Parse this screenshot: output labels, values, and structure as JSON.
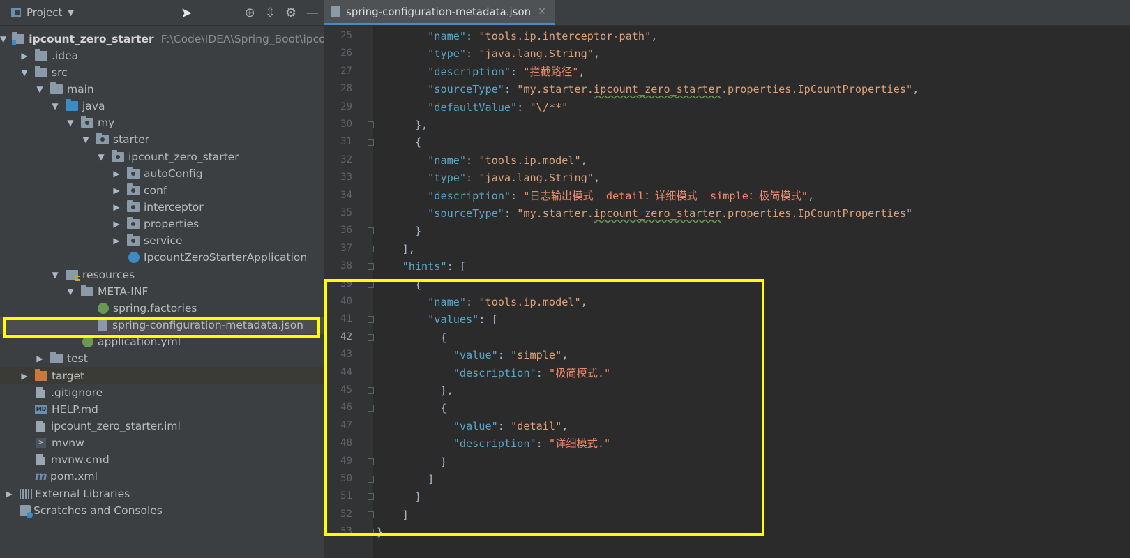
{
  "project_panel": {
    "title": "Project",
    "tree": [
      {
        "label": "ipcount_zero_starter",
        "path": "F:\\Code\\IDEA\\Spring_Boot\\ipcount",
        "depth": 0,
        "expanded": true,
        "icon": "module-folder-icon",
        "bold": true
      },
      {
        "label": ".idea",
        "depth": 1,
        "expanded": false,
        "icon": "folder-icon"
      },
      {
        "label": "src",
        "depth": 1,
        "expanded": true,
        "icon": "folder-icon"
      },
      {
        "label": "main",
        "depth": 2,
        "expanded": true,
        "icon": "folder-icon"
      },
      {
        "label": "java",
        "depth": 3,
        "expanded": true,
        "icon": "source-folder-icon"
      },
      {
        "label": "my",
        "depth": 4,
        "expanded": true,
        "icon": "package-icon"
      },
      {
        "label": "starter",
        "depth": 5,
        "expanded": true,
        "icon": "package-icon"
      },
      {
        "label": "ipcount_zero_starter",
        "depth": 6,
        "expanded": true,
        "icon": "package-icon"
      },
      {
        "label": "autoConfig",
        "depth": 7,
        "expanded": false,
        "icon": "package-icon"
      },
      {
        "label": "conf",
        "depth": 7,
        "expanded": false,
        "icon": "package-icon"
      },
      {
        "label": "interceptor",
        "depth": 7,
        "expanded": false,
        "icon": "package-icon"
      },
      {
        "label": "properties",
        "depth": 7,
        "expanded": false,
        "icon": "package-icon"
      },
      {
        "label": "service",
        "depth": 7,
        "expanded": false,
        "icon": "package-icon"
      },
      {
        "label": "IpcountZeroStarterApplication",
        "depth": 7,
        "icon": "spring-boot-app-icon"
      },
      {
        "label": "resources",
        "depth": 3,
        "expanded": true,
        "icon": "resources-folder-icon"
      },
      {
        "label": "META-INF",
        "depth": 4,
        "expanded": true,
        "icon": "folder-icon"
      },
      {
        "label": "spring.factories",
        "depth": 5,
        "icon": "spring-leaf-icon"
      },
      {
        "label": "spring-configuration-metadata.json",
        "depth": 5,
        "icon": "json-file-icon",
        "selected": true
      },
      {
        "label": "application.yml",
        "depth": 4,
        "icon": "spring-config-icon"
      },
      {
        "label": "test",
        "depth": 2,
        "expanded": false,
        "icon": "folder-icon"
      },
      {
        "label": "target",
        "depth": 1,
        "expanded": false,
        "icon": "excluded-folder-icon"
      },
      {
        "label": ".gitignore",
        "depth": 1,
        "icon": "text-file-icon"
      },
      {
        "label": "HELP.md",
        "depth": 1,
        "icon": "markdown-file-icon"
      },
      {
        "label": "ipcount_zero_starter.iml",
        "depth": 1,
        "icon": "iml-file-icon"
      },
      {
        "label": "mvnw",
        "depth": 1,
        "icon": "shell-file-icon"
      },
      {
        "label": "mvnw.cmd",
        "depth": 1,
        "icon": "text-file-icon"
      },
      {
        "label": "pom.xml",
        "depth": 1,
        "icon": "maven-icon"
      },
      {
        "label": "External Libraries",
        "depth": 0,
        "expanded": false,
        "icon": "libraries-icon"
      },
      {
        "label": "Scratches and Consoles",
        "depth": 0,
        "icon": "scratches-icon"
      }
    ]
  },
  "editor": {
    "tab_title": "spring-configuration-metadata.json",
    "current_line": 42,
    "lines": [
      {
        "n": 25,
        "text": "        \"name\": \"tools.ip.interceptor-path\","
      },
      {
        "n": 26,
        "text": "        \"type\": \"java.lang.String\","
      },
      {
        "n": 27,
        "text": "        \"description\": \"拦截路径\","
      },
      {
        "n": 28,
        "text": "        \"sourceType\": \"my.starter.ipcount_zero_starter.properties.IpCountProperties\","
      },
      {
        "n": 29,
        "text": "        \"defaultValue\": \"\\/**\""
      },
      {
        "n": 30,
        "text": "      },"
      },
      {
        "n": 31,
        "text": "      {"
      },
      {
        "n": 32,
        "text": "        \"name\": \"tools.ip.model\","
      },
      {
        "n": 33,
        "text": "        \"type\": \"java.lang.String\","
      },
      {
        "n": 34,
        "text": "        \"description\": \"日志输出模式  detail：详细模式  simple：极简模式\","
      },
      {
        "n": 35,
        "text": "        \"sourceType\": \"my.starter.ipcount_zero_starter.properties.IpCountProperties\""
      },
      {
        "n": 36,
        "text": "      }"
      },
      {
        "n": 37,
        "text": "    ],"
      },
      {
        "n": 38,
        "text": "    \"hints\": ["
      },
      {
        "n": 39,
        "text": "      {"
      },
      {
        "n": 40,
        "text": "        \"name\": \"tools.ip.model\","
      },
      {
        "n": 41,
        "text": "        \"values\": ["
      },
      {
        "n": 42,
        "text": "          {"
      },
      {
        "n": 43,
        "text": "            \"value\": \"simple\","
      },
      {
        "n": 44,
        "text": "            \"description\": \"极简模式.\""
      },
      {
        "n": 45,
        "text": "          },"
      },
      {
        "n": 46,
        "text": "          {"
      },
      {
        "n": 47,
        "text": "            \"value\": \"detail\","
      },
      {
        "n": 48,
        "text": "            \"description\": \"详细模式.\""
      },
      {
        "n": 49,
        "text": "          }"
      },
      {
        "n": 50,
        "text": "        ]"
      },
      {
        "n": 51,
        "text": "      }"
      },
      {
        "n": 52,
        "text": "    ]"
      },
      {
        "n": 53,
        "text": "}"
      }
    ]
  },
  "colors": {
    "highlight": "#ffff00",
    "json_key": "#58a6c8",
    "json_string": "#dfa27a",
    "background": "#2b2b2b",
    "panel": "#3c3f41"
  }
}
